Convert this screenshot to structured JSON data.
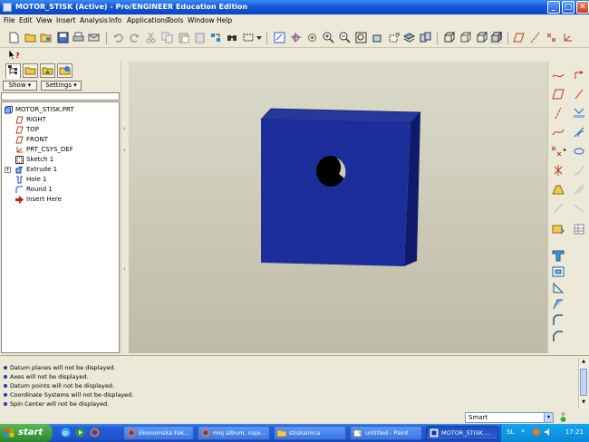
{
  "window": {
    "title": "MOTOR_STISK (Active) - Pro/ENGINEER Education Edition",
    "minimize_label": "_",
    "maximize_label": "□",
    "close_label": "✕"
  },
  "menu": [
    "File",
    "Edit",
    "View",
    "Insert",
    "Analysis",
    "Info",
    "Applications",
    "Tools",
    "Window",
    "Help"
  ],
  "navigator": {
    "show_label": "Show ▾",
    "settings_label": "Settings ▾"
  },
  "model_tree": [
    {
      "label": "MOTOR_STISK.PRT",
      "icon": "part-icon",
      "indent": 0
    },
    {
      "label": "RIGHT",
      "icon": "datum-plane-icon",
      "indent": 1
    },
    {
      "label": "TOP",
      "icon": "datum-plane-icon",
      "indent": 1
    },
    {
      "label": "FRONT",
      "icon": "datum-plane-icon",
      "indent": 1
    },
    {
      "label": "PRT_CSYS_DEF",
      "icon": "csys-icon",
      "indent": 1
    },
    {
      "label": "Sketch 1",
      "icon": "sketch-icon",
      "indent": 1
    },
    {
      "label": "Extrude 1",
      "icon": "extrude-icon",
      "indent": 1,
      "expandable": true
    },
    {
      "label": "Hole 1",
      "icon": "hole-icon",
      "indent": 1
    },
    {
      "label": "Round 1",
      "icon": "round-icon",
      "indent": 1
    },
    {
      "label": "Insert Here",
      "icon": "insert-here-icon",
      "indent": 1
    }
  ],
  "messages": [
    "Datum planes will not be displayed.",
    "Axes will not be displayed.",
    "Datum points will not be displayed.",
    "Coordinate Systems will not be displayed.",
    "Spin Center will not be displayed."
  ],
  "filter": {
    "value": "Smart",
    "arrow": "▾"
  },
  "taskbar": {
    "start_label": "start",
    "tasks": [
      {
        "label": "Ekonomska Fak...",
        "icon": "firefox-icon",
        "active": false
      },
      {
        "label": "moj album, naje...",
        "icon": "firefox-icon",
        "active": false
      },
      {
        "label": "stiskalnica",
        "icon": "folder-icon",
        "active": false
      },
      {
        "label": "untitled - Paint",
        "icon": "paint-icon",
        "active": false
      },
      {
        "label": "MOTOR_STISK ...",
        "icon": "proe-icon",
        "active": true
      }
    ],
    "language": "SL",
    "clock": "17:21"
  },
  "colors": {
    "model_fill": "#1c2e9c",
    "model_side": "#0f1a6a",
    "model_top": "#25389e",
    "viewport_bg": "#cdcbb8"
  }
}
